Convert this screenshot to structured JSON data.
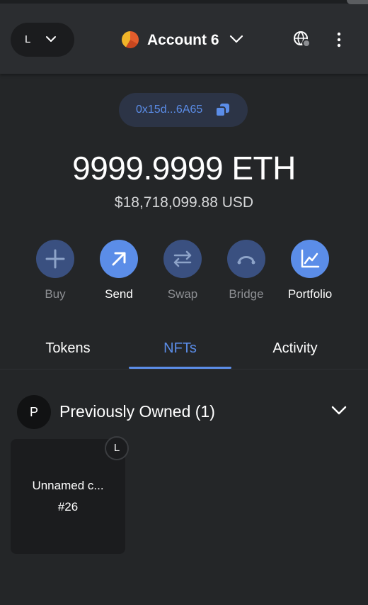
{
  "header": {
    "network_letter": "L",
    "account_name": "Account 6"
  },
  "address": {
    "short": "0x15d...6A65"
  },
  "balance": {
    "crypto": "9999.9999 ETH",
    "fiat": "$18,718,099.88 USD"
  },
  "actions": [
    {
      "label": "Buy",
      "icon": "plus-icon",
      "enabled": false
    },
    {
      "label": "Send",
      "icon": "arrow-up-right-icon",
      "enabled": true
    },
    {
      "label": "Swap",
      "icon": "swap-arrows-icon",
      "enabled": false
    },
    {
      "label": "Bridge",
      "icon": "bridge-icon",
      "enabled": false
    },
    {
      "label": "Portfolio",
      "icon": "chart-icon",
      "enabled": true
    }
  ],
  "tabs": [
    {
      "label": "Tokens",
      "active": false
    },
    {
      "label": "NFTs",
      "active": true
    },
    {
      "label": "Activity",
      "active": false
    }
  ],
  "collection": {
    "avatar_letter": "P",
    "title": "Previously Owned (1)",
    "items": [
      {
        "name": "Unnamed c...",
        "id": "#26",
        "badge": "L"
      }
    ]
  },
  "colors": {
    "accent": "#5b8de8",
    "background": "#242628",
    "header": "#2b2d30"
  }
}
